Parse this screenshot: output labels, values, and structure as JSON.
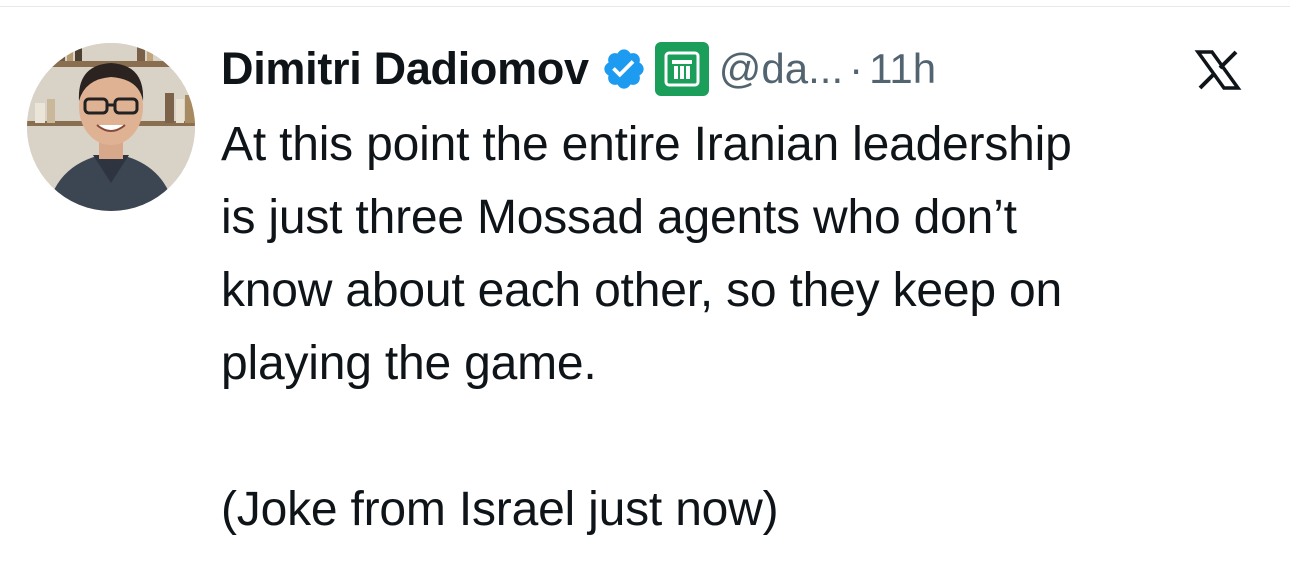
{
  "author": {
    "display_name": "Dimitri Dadiomov",
    "handle": "@da...",
    "separator": "·",
    "timestamp": "11h",
    "verified_badge_icon": "verified-check-icon",
    "affiliate_badge_icon": "company-logo-icon",
    "affiliate_badge_color": "#1a9e5a",
    "verified_color": "#1d9bf0"
  },
  "platform": {
    "logo_icon": "x-logo-icon"
  },
  "tweet": {
    "lines": [
      "At this point the entire Iranian leadership",
      "is just three Mossad agents who don’t",
      "know about each other, so they keep on",
      "playing the game."
    ],
    "footnote": "(Joke from Israel just now)"
  }
}
